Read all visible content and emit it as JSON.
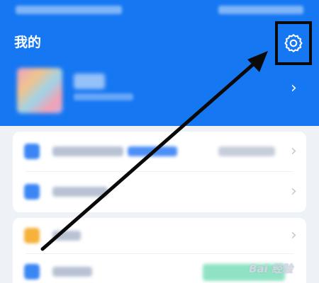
{
  "header": {
    "title": "我的",
    "settings_icon": "gear-icon",
    "chevron": "›",
    "background_color": "#1677f2"
  },
  "annotation": {
    "highlight_color": "#0a0a0a",
    "arrow_color": "#0a0a0a"
  },
  "list": {
    "chevron": "›",
    "icon_colors": [
      "#3b86f4",
      "#3b86f4",
      "#f6b23a",
      "#3b86f4"
    ],
    "tag_color": "#4c8ff7",
    "promo_color": "#8fe3c4"
  },
  "watermark": {
    "text": "Bai 经验"
  }
}
